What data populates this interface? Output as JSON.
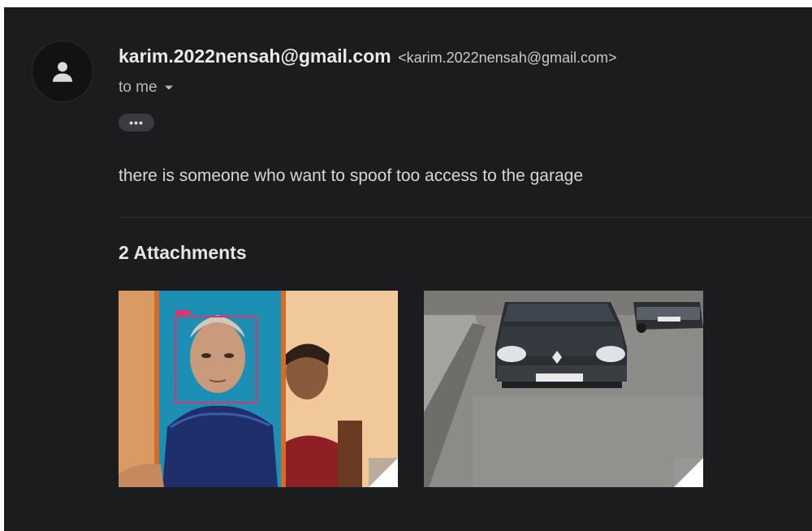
{
  "email": {
    "sender_name": "karim.2022nensah@gmail.com",
    "sender_email": "<karim.2022nensah@gmail.com>",
    "recipient_label": "to me",
    "more_label": "•••",
    "body": "there is someone who want to spoof too access to the garage"
  },
  "attachments": {
    "heading": "2 Attachments",
    "items": [
      {
        "description_icon": "image-thumbnail"
      },
      {
        "description_icon": "image-thumbnail"
      }
    ]
  },
  "icons": {
    "avatar": "person-icon",
    "recipient_dropdown": "caret-down-icon",
    "more": "ellipsis-icon"
  },
  "colors": {
    "background": "#1b1c1e",
    "text_primary": "#e9eaec",
    "text_secondary": "#b8b9bc"
  }
}
